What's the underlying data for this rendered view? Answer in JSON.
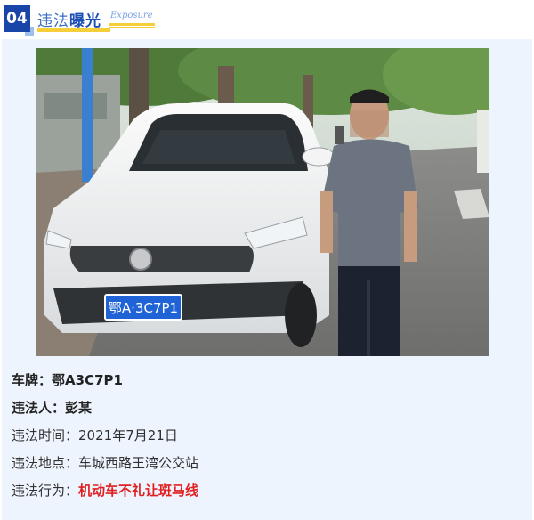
{
  "header": {
    "number": "04",
    "title_prefix": "违法",
    "title_bold": "曝光",
    "subtitle_en": "Exposure"
  },
  "photo": {
    "plate_text": "鄂A·3C7P1"
  },
  "info": {
    "plate_label": "车牌：",
    "plate_value": "鄂A3C7P1",
    "person_label": "违法人：",
    "person_value": "彭某",
    "time_label": "违法时间：",
    "time_value": "2021年7月21日",
    "place_label": "违法地点：",
    "place_value": "车城西路王湾公交站",
    "act_label": "违法行为：",
    "act_value": "机动车不礼让斑马线"
  },
  "colors": {
    "badge": "#1a45a8",
    "accent_yellow": "#f4cf3a",
    "panel_bg": "#eef4fd",
    "highlight_red": "#e02020"
  }
}
